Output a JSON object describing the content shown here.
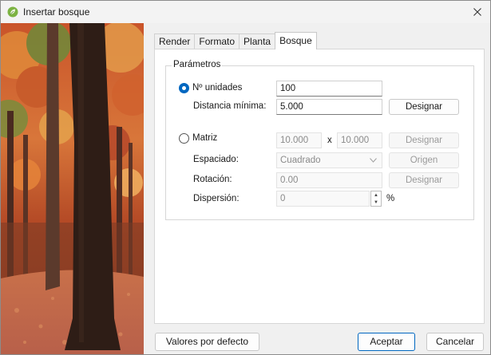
{
  "window": {
    "title": "Insertar bosque",
    "close_label": "✕"
  },
  "tabs": [
    {
      "label": "Render"
    },
    {
      "label": "Formato"
    },
    {
      "label": "Planta"
    },
    {
      "label": "Bosque",
      "active": true
    }
  ],
  "params": {
    "group_title": "Parámetros",
    "units": {
      "label": "Nº unidades",
      "value": "100",
      "selected": true
    },
    "min_distance": {
      "label": "Distancia mínima:",
      "value": "5.000",
      "button": "Designar"
    },
    "matrix": {
      "label": "Matriz",
      "value_x": "10.000",
      "times": "x",
      "value_y": "10.000",
      "button": "Designar",
      "selected": false
    },
    "spacing": {
      "label": "Espaciado:",
      "value": "Cuadrado",
      "button": "Origen"
    },
    "rotation": {
      "label": "Rotación:",
      "value": "0.00",
      "button": "Designar"
    },
    "dispersion": {
      "label": "Dispersión:",
      "value": "0",
      "unit": "%"
    }
  },
  "footer": {
    "defaults_button": "Valores por defecto",
    "accept_button": "Aceptar",
    "cancel_button": "Cancelar"
  },
  "colors": {
    "accent": "#0067c0",
    "panel": "#ffffff",
    "background": "#f0f0f0"
  }
}
